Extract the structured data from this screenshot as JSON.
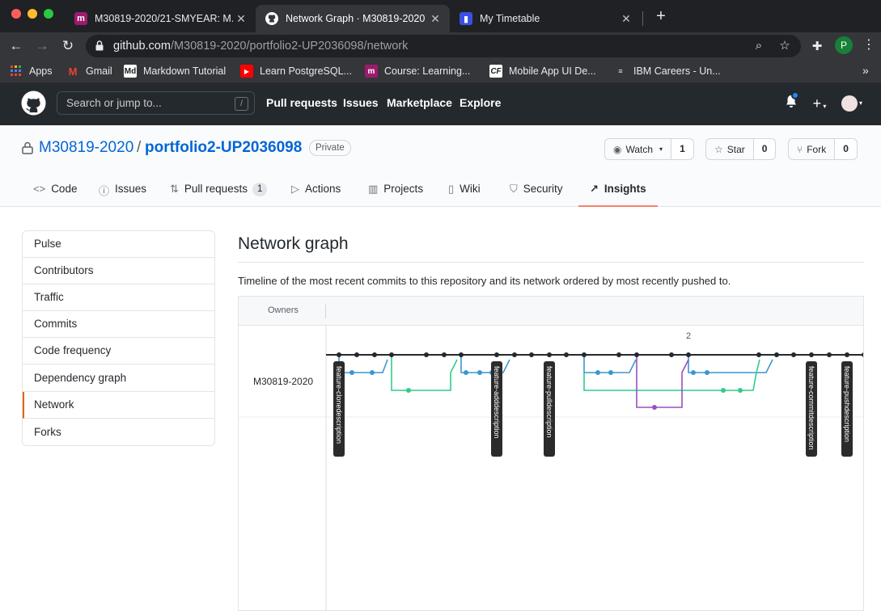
{
  "browser": {
    "tabs": [
      {
        "title": "M30819-2020/21-SMYEAR: M...",
        "favicon": "moodle-icon",
        "active": false
      },
      {
        "title": "Network Graph · M30819-2020",
        "favicon": "github-icon",
        "active": true
      },
      {
        "title": "My Timetable",
        "favicon": "timetable-icon",
        "active": false
      }
    ],
    "new_tab": "+",
    "url_host": "github.com",
    "url_path": "/M30819-2020/portfolio2-UP2036098/network",
    "profile_initial": "P",
    "bookmarks": [
      {
        "label": "Apps",
        "icon": "apps-grid-icon"
      },
      {
        "label": "Gmail",
        "icon": "gmail-icon"
      },
      {
        "label": "Markdown Tutorial",
        "icon": "markdown-icon"
      },
      {
        "label": "Learn PostgreSQL...",
        "icon": "youtube-icon"
      },
      {
        "label": "Course: Learning...",
        "icon": "moodle-icon"
      },
      {
        "label": "Mobile App UI De...",
        "icon": "codeforces-icon"
      },
      {
        "label": "IBM Careers - Un...",
        "icon": "ibm-icon"
      }
    ],
    "bookmarks_more": "»"
  },
  "github": {
    "search_placeholder": "Search or jump to...",
    "search_shortcut": "/",
    "nav": [
      "Pull requests",
      "Issues",
      "Marketplace",
      "Explore"
    ]
  },
  "repo": {
    "owner": "M30819-2020",
    "separator": "/",
    "name": "portfolio2-UP2036098",
    "visibility": "Private",
    "watch": {
      "label": "Watch",
      "count": "1"
    },
    "star": {
      "label": "Star",
      "count": "0"
    },
    "fork": {
      "label": "Fork",
      "count": "0"
    },
    "tabs": [
      {
        "label": "Code",
        "icon": "code-icon"
      },
      {
        "label": "Issues",
        "icon": "issue-icon"
      },
      {
        "label": "Pull requests",
        "icon": "pull-request-icon",
        "count": "1"
      },
      {
        "label": "Actions",
        "icon": "play-icon"
      },
      {
        "label": "Projects",
        "icon": "project-icon"
      },
      {
        "label": "Wiki",
        "icon": "book-icon"
      },
      {
        "label": "Security",
        "icon": "shield-icon"
      },
      {
        "label": "Insights",
        "icon": "graph-icon",
        "selected": true
      }
    ]
  },
  "sidebar": {
    "items": [
      "Pulse",
      "Contributors",
      "Traffic",
      "Commits",
      "Code frequency",
      "Dependency graph",
      "Network",
      "Forks"
    ],
    "selected": "Network"
  },
  "main": {
    "title": "Network graph",
    "description": "Timeline of the most recent commits to this repository and its network ordered by most recently pushed to.",
    "owners_header": "Owners",
    "owner": "M30819-2020",
    "date_marker": "2",
    "branches": [
      "feature-clonedescription",
      "feature-adddescription",
      "feature-pulldescription",
      "feature-commitdescription",
      "feature-pushdescription"
    ],
    "colors": {
      "main": "#24292e",
      "blue": "#3b96d4",
      "green": "#2ecc8a",
      "purple": "#9b4fc0"
    }
  }
}
